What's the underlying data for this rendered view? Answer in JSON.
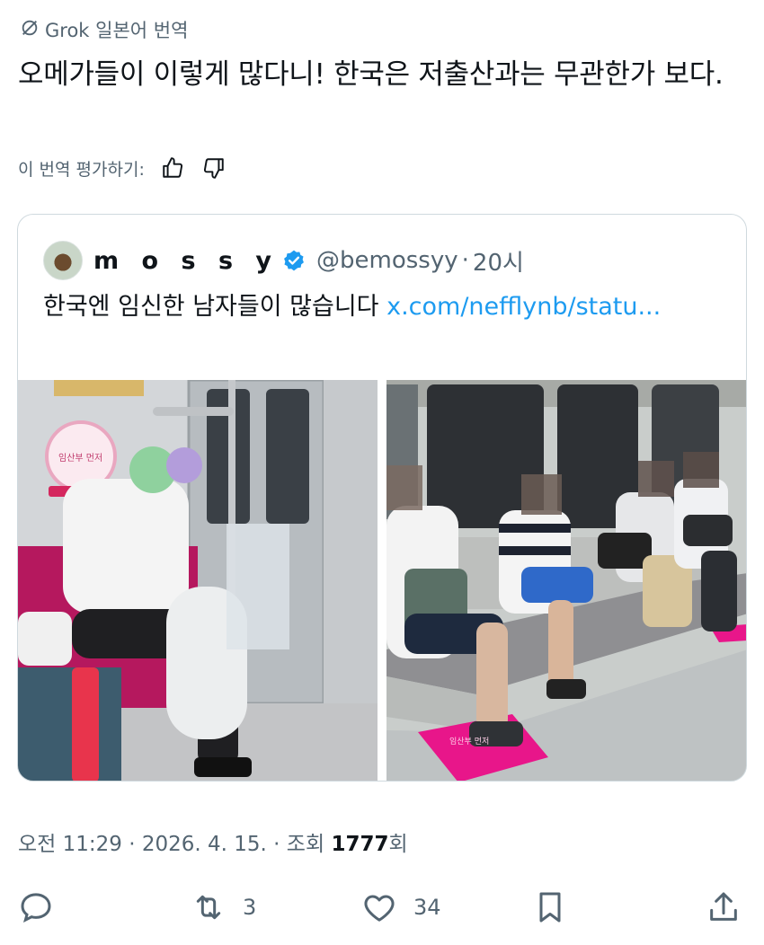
{
  "grok": {
    "label": "Grok 일본어 번역"
  },
  "tweet": {
    "text": "오메가들이 이렇게 많다니! 한국은 저출산과는 무관한가 보다."
  },
  "rating": {
    "label": "이 번역 평가하기:"
  },
  "quote": {
    "name": "m o s s y",
    "handle": "@bemossyy",
    "time": "20시",
    "text": "한국엔 임신한 남자들이 많습니다 ",
    "link": "x.com/nefflynb/statu...",
    "photo1_sign": "임산부 먼저",
    "photo2_sign": "임산부 먼저"
  },
  "meta": {
    "time": "오전 11:29",
    "date": "2026. 4. 15.",
    "views_label": "조회",
    "views": "1777",
    "views_suffix": "회"
  },
  "actions": {
    "reply_count": "",
    "retweet_count": "3",
    "like_count": "34"
  },
  "colors": {
    "text": "#0f1419",
    "secondary": "#536471",
    "link": "#1d9bf0",
    "border": "#cfd9de",
    "verified": "#1d9bf0",
    "pink_seat": "#e8168a"
  }
}
